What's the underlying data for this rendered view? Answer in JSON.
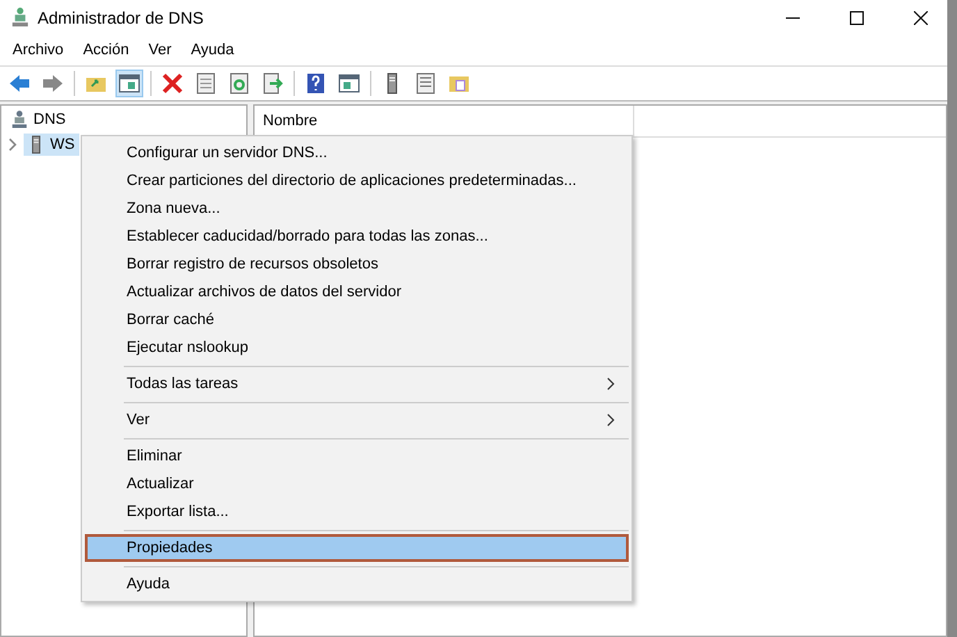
{
  "window": {
    "title": "Administrador de DNS"
  },
  "menu_bar": [
    "Archivo",
    "Acción",
    "Ver",
    "Ayuda"
  ],
  "tree": {
    "label": "DNS",
    "children": [
      {
        "label": "WS",
        "expanded": false,
        "selected": true
      }
    ]
  },
  "list": {
    "columns": [
      "Nombre"
    ]
  },
  "context_menu": [
    {
      "kind": "item",
      "label": "Configurar un servidor DNS...",
      "selected": false
    },
    {
      "kind": "item",
      "label": "Crear particiones del directorio de aplicaciones predeterminadas...",
      "selected": false
    },
    {
      "kind": "item",
      "label": "Zona nueva...",
      "selected": false
    },
    {
      "kind": "item",
      "label": "Establecer caducidad/borrado para todas las zonas...",
      "selected": false
    },
    {
      "kind": "item",
      "label": "Borrar registro de recursos obsoletos",
      "selected": false
    },
    {
      "kind": "item",
      "label": "Actualizar archivos de datos del servidor",
      "selected": false
    },
    {
      "kind": "item",
      "label": "Borrar caché",
      "selected": false
    },
    {
      "kind": "item",
      "label": "Ejecutar nslookup",
      "selected": false
    },
    {
      "kind": "separator"
    },
    {
      "kind": "submenu",
      "label": "Todas las tareas",
      "selected": false
    },
    {
      "kind": "separator"
    },
    {
      "kind": "submenu",
      "label": "Ver",
      "selected": false
    },
    {
      "kind": "separator"
    },
    {
      "kind": "item",
      "label": "Eliminar",
      "selected": false
    },
    {
      "kind": "item",
      "label": "Actualizar",
      "selected": false
    },
    {
      "kind": "item",
      "label": "Exportar lista...",
      "selected": false
    },
    {
      "kind": "separator"
    },
    {
      "kind": "item",
      "label": "Propiedades",
      "selected": true
    },
    {
      "kind": "separator"
    },
    {
      "kind": "item",
      "label": "Ayuda",
      "selected": false
    }
  ]
}
